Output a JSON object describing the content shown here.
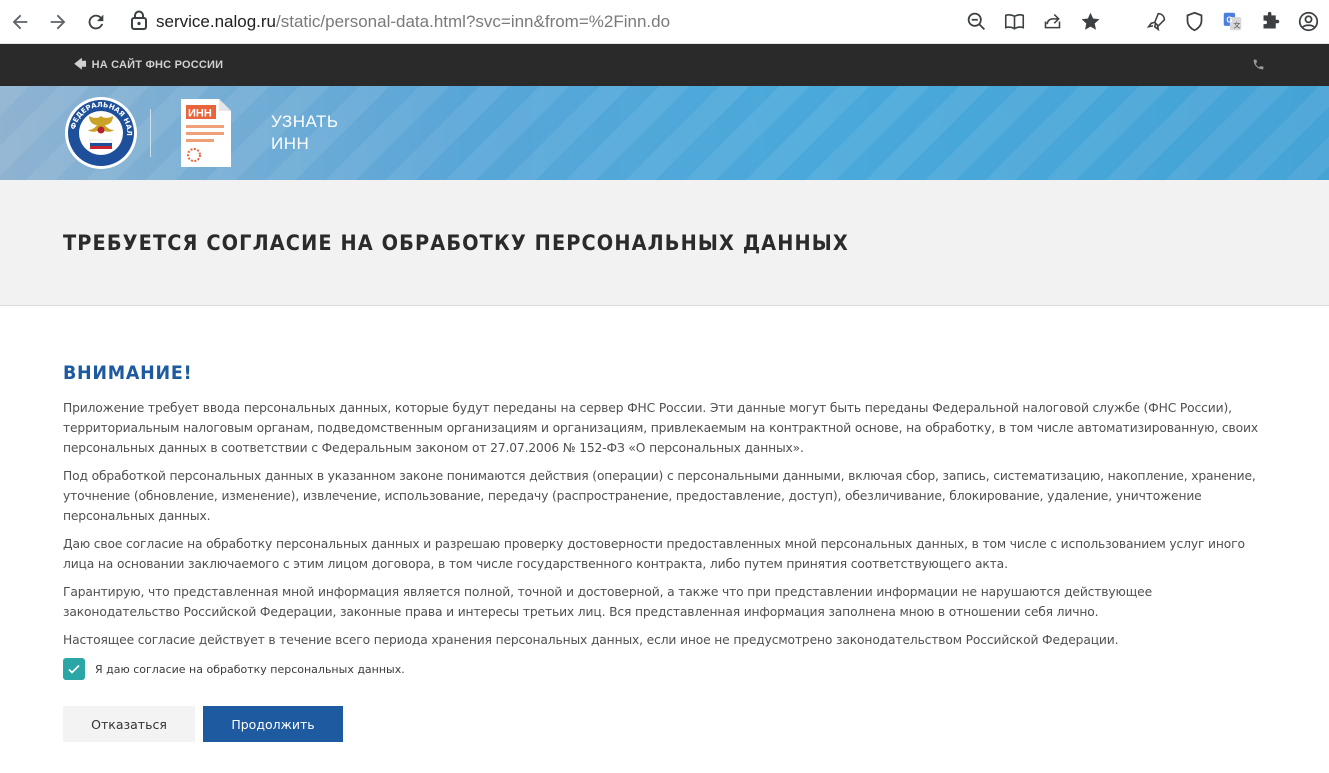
{
  "browser": {
    "url_domain": "service.nalog.ru",
    "url_path": "/static/personal-data.html?svc=inn&from=%2Finn.do"
  },
  "top_nav": {
    "back_link": "НА САЙТ ФНС РОССИИ"
  },
  "banner": {
    "emblem_text": "ФЕДЕРАЛЬНАЯ НАЛОГОВАЯ СЛУЖБА",
    "doc_label": "ИНН",
    "title_line1": "УЗНАТЬ",
    "title_line2": "ИНН"
  },
  "page": {
    "title": "ТРЕБУЕТСЯ СОГЛАСИЕ НА ОБРАБОТКУ ПЕРСОНАЛЬНЫХ ДАННЫХ",
    "attention": "ВНИМАНИЕ!",
    "paragraphs": [
      "Приложение требует ввода персональных данных, которые будут переданы на сервер ФНС России. Эти данные могут быть переданы Федеральной налоговой службе (ФНС России), территориальным налоговым органам, подведомственным организациям и организациям, привлекаемым на контрактной основе, на обработку, в том числе автоматизированную, своих персональных данных в соответствии с Федеральным законом от 27.07.2006 № 152-ФЗ «О персональных данных».",
      "Под обработкой персональных данных в указанном законе понимаются действия (операции) с персональными данными, включая сбор, запись, систематизацию, накопление, хранение, уточнение (обновление, изменение), извлечение, использование, передачу (распространение, предоставление, доступ), обезличивание, блокирование, удаление, уничтожение персональных данных.",
      "Даю свое согласие на обработку персональных данных и разрешаю проверку достоверности предоставленных мной персональных данных, в том числе с использованием услуг иного лица на основании заключаемого с этим лицом договора, в том числе государственного контракта, либо путем принятия соответствующего акта.",
      "Гарантирую, что представленная мной информация является полной, точной и достоверной, а также что при представлении информации не нарушаются действующее законодательство Российской Федерации, законные права и интересы третьих лиц. Вся представленная информация заполнена мною в отношении себя лично.",
      "Настоящее согласие действует в течение всего периода хранения персональных данных, если иное не предусмотрено законодательством Российской Федерации."
    ],
    "consent_label": "Я даю согласие на обработку персональных данных.",
    "consent_checked": true,
    "decline_label": "Отказаться",
    "continue_label": "Продолжить"
  },
  "colors": {
    "brand_blue": "#1d5aa0",
    "checkbox_teal": "#2aa6a6",
    "top_nav_bg": "#2a2a2a"
  }
}
